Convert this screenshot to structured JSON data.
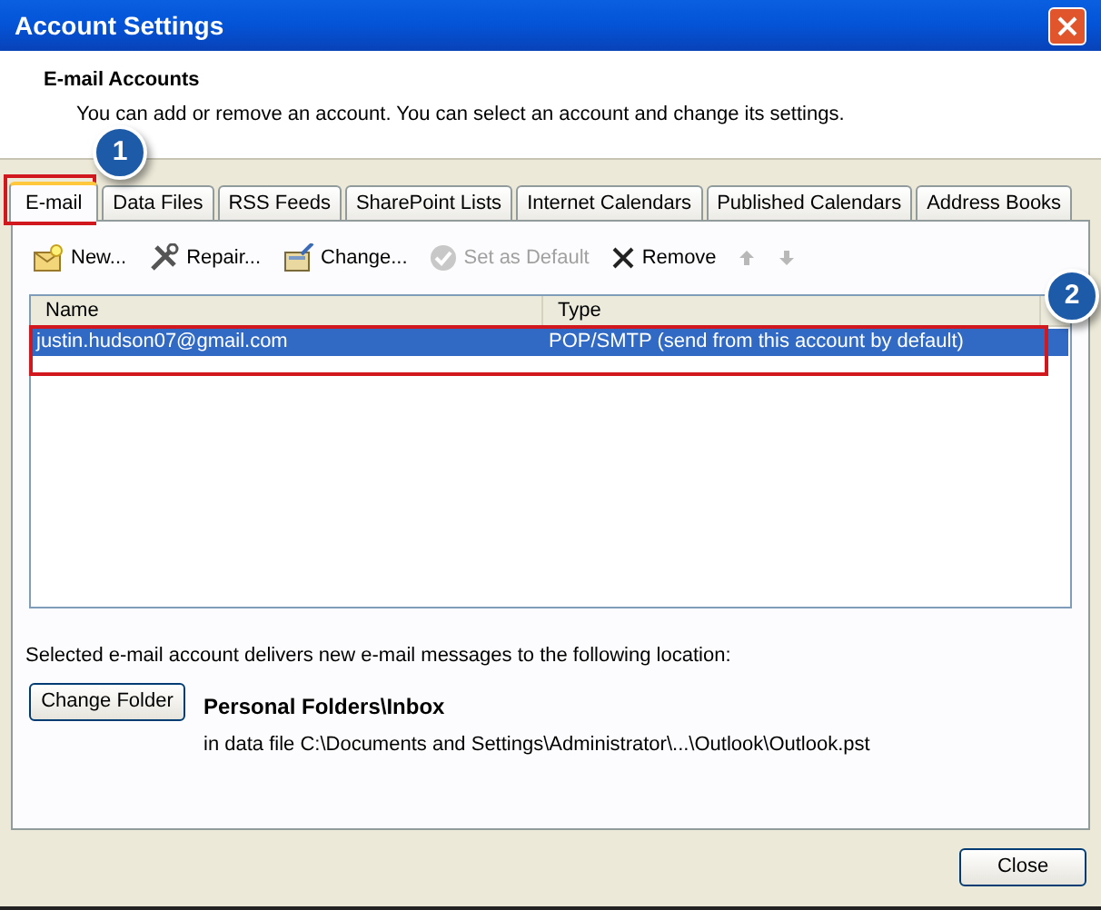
{
  "window": {
    "title": "Account Settings"
  },
  "header": {
    "title": "E-mail Accounts",
    "description": "You can add or remove an account. You can select an account and change its settings."
  },
  "tabs": [
    {
      "label": "E-mail",
      "selected": true
    },
    {
      "label": "Data Files",
      "selected": false
    },
    {
      "label": "RSS Feeds",
      "selected": false
    },
    {
      "label": "SharePoint Lists",
      "selected": false
    },
    {
      "label": "Internet Calendars",
      "selected": false
    },
    {
      "label": "Published Calendars",
      "selected": false
    },
    {
      "label": "Address Books",
      "selected": false
    }
  ],
  "toolbar": [
    {
      "kind": "new",
      "label": "New...",
      "disabled": false
    },
    {
      "kind": "repair",
      "label": "Repair...",
      "disabled": false
    },
    {
      "kind": "change",
      "label": "Change...",
      "disabled": false
    },
    {
      "kind": "default",
      "label": "Set as Default",
      "disabled": true
    },
    {
      "kind": "remove",
      "label": "Remove",
      "disabled": false
    },
    {
      "kind": "up",
      "disabled": true
    },
    {
      "kind": "down",
      "disabled": true
    }
  ],
  "table": {
    "columns": [
      "Name",
      "Type"
    ],
    "rows": [
      {
        "cells": [
          "justin.hudson07@gmail.com",
          "POP/SMTP (send from this account by default)"
        ],
        "selected": true
      }
    ]
  },
  "delivery": {
    "text": "Selected e-mail account delivers new e-mail messages to the following location:",
    "button": "Change Folder",
    "folder": "Personal Folders\\Inbox",
    "path": "in data file C:\\Documents and Settings\\Administrator\\...\\Outlook\\Outlook.pst"
  },
  "callouts": [
    {
      "label": "1"
    },
    {
      "label": "2"
    }
  ],
  "buttons": [
    "Close"
  ]
}
